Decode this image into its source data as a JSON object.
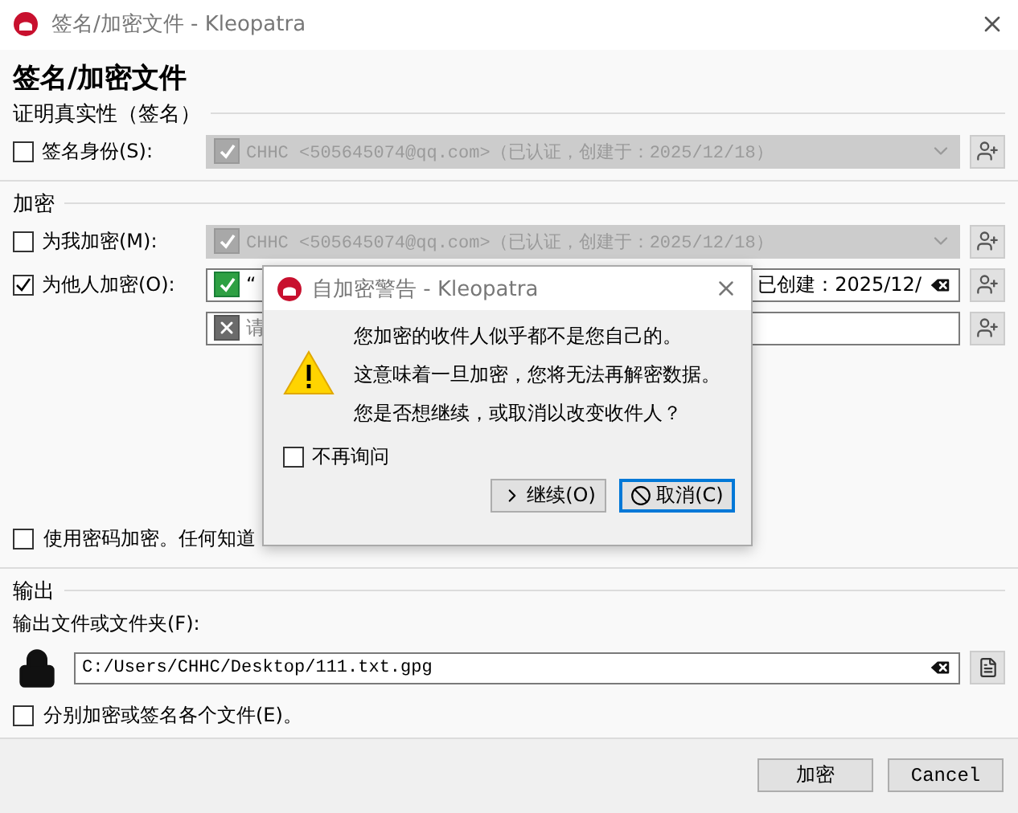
{
  "window": {
    "title": "签名/加密文件 - Kleopatra"
  },
  "heading": "签名/加密文件",
  "sign_section": {
    "title": "证明真实性（签名）",
    "sign_as": {
      "label": "签名身份(S):",
      "checked": false,
      "disabled": true,
      "value": "CHHC <505645074@qq.com>（已认证，创建于：2025/12/18）"
    }
  },
  "encrypt_section": {
    "title": "加密",
    "encrypt_for_me": {
      "label": "为我加密(M):",
      "checked": false,
      "disabled": true,
      "value": "CHHC <505645074@qq.com>（已认证，创建于：2025/12/18）"
    },
    "encrypt_for_others": {
      "label": "为他人加密(O):",
      "checked": true
    },
    "recipients": [
      {
        "kind": "valid",
        "text_start": "“",
        "text_end": "已创建：2025/12/"
      },
      {
        "kind": "empty",
        "placeholder": "请"
      }
    ],
    "password": {
      "label": "使用密码加密。任何知道",
      "checked": false
    }
  },
  "output_section": {
    "title": "输出",
    "label": "输出文件或文件夹(F):",
    "path": "C:/Users/CHHC/Desktop/111.txt.gpg",
    "separate": {
      "label": "分别加密或签名各个文件(E)。",
      "checked": false
    }
  },
  "buttons": [
    {
      "label": "加密"
    },
    {
      "label": "Cancel"
    }
  ],
  "dialog": {
    "title": "自加密警告 - Kleopatra",
    "lines": [
      "您加密的收件人似乎都不是您自己的。",
      "这意味着一旦加密，您将无法再解密数据。",
      "您是否想继续，或取消以改变收件人？"
    ],
    "dont_ask": {
      "label": "不再询问",
      "checked": false
    },
    "buttons": [
      {
        "label": "继续(O)",
        "kind": "continue",
        "default": false
      },
      {
        "label": "取消(C)",
        "kind": "cancel",
        "default": true
      }
    ]
  }
}
